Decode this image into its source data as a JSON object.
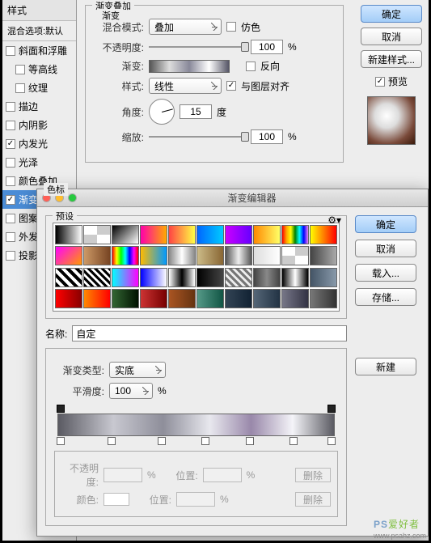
{
  "sidebar": {
    "header": "样式",
    "sub": "混合选项:默认",
    "items": [
      {
        "label": "斜面和浮雕",
        "checked": false
      },
      {
        "label": "等高线",
        "checked": false,
        "indent": true
      },
      {
        "label": "纹理",
        "checked": false,
        "indent": true
      },
      {
        "label": "描边",
        "checked": false
      },
      {
        "label": "内阴影",
        "checked": false
      },
      {
        "label": "内发光",
        "checked": true
      },
      {
        "label": "光泽",
        "checked": false
      },
      {
        "label": "颜色叠加",
        "checked": false
      },
      {
        "label": "渐变叠加",
        "checked": true,
        "active": true
      },
      {
        "label": "图案叠加",
        "checked": false
      },
      {
        "label": "外发光",
        "checked": false
      },
      {
        "label": "投影",
        "checked": false
      }
    ]
  },
  "gradientOverlay": {
    "legend": "渐变叠加",
    "subLegend": "渐变",
    "blendModeLabel": "混合模式:",
    "blendMode": "叠加",
    "ditherLabel": "仿色",
    "opacityLabel": "不透明度:",
    "opacity": "100",
    "pct": "%",
    "gradientLabel": "渐变:",
    "reverseLabel": "反向",
    "styleLabel": "样式:",
    "style": "线性",
    "alignLabel": "与图层对齐",
    "angleLabel": "角度:",
    "angle": "15",
    "deg": "度",
    "scaleLabel": "缩放:",
    "scale": "100"
  },
  "rightButtons": {
    "ok": "确定",
    "cancel": "取消",
    "newStyle": "新建样式...",
    "preview": "预览"
  },
  "editor": {
    "title": "渐变编辑器",
    "presetLabel": "预设",
    "nameLabel": "名称:",
    "nameValue": "自定",
    "newBtn": "新建",
    "ok": "确定",
    "cancel": "取消",
    "load": "载入...",
    "save": "存储...",
    "typeLabel": "渐变类型:",
    "type": "实底",
    "smoothLabel": "平滑度:",
    "smooth": "100",
    "pct": "%",
    "stopsLegend": "色标",
    "opLabel": "不透明度:",
    "posLabel": "位置:",
    "delBtn": "删除",
    "colorLabel": "颜色:"
  },
  "swatches": [
    "linear-gradient(90deg,#000,#fff)",
    "repeating-conic-gradient(#ccc 0 25%,#fff 0 50%)",
    "linear-gradient(135deg,#000,#fff)",
    "linear-gradient(90deg,#f0a,#fa0)",
    "linear-gradient(90deg,#f44,#ff4)",
    "linear-gradient(90deg,#06f,#0cf)",
    "linear-gradient(90deg,#c0f,#60f)",
    "linear-gradient(90deg,#f80,#ff6)",
    "linear-gradient(90deg,red,orange,yellow,green,cyan,blue,violet)",
    "linear-gradient(90deg,#ff0,#f00)",
    "linear-gradient(135deg,#f0f,#f90)",
    "linear-gradient(90deg,#c96,#742)",
    "linear-gradient(90deg,red,yellow,lime,cyan,blue,magenta,red)",
    "linear-gradient(90deg,#fb0,#09f)",
    "linear-gradient(90deg,#888,#fff,#888)",
    "linear-gradient(90deg,#cb8,#863)",
    "linear-gradient(90deg,#555,#eee,#555)",
    "linear-gradient(90deg,#ddd,#fff)",
    "repeating-conic-gradient(#ccc 0 25%,#fff 0 50%)",
    "linear-gradient(90deg,#444,#aaa)",
    "repeating-linear-gradient(45deg,#000 0 4px,#fff 4px 8px)",
    "repeating-linear-gradient(45deg,#000 0 3px,#fff 3px 6px)",
    "linear-gradient(90deg,#0ff,#f0f)",
    "linear-gradient(90deg,#00f,#fff)",
    "linear-gradient(90deg,#fff,#000,#fff)",
    "linear-gradient(90deg,#000,#444)",
    "repeating-linear-gradient(45deg,#777 0 3px,#eee 3px 6px)",
    "linear-gradient(90deg,#444,#888,#444)",
    "linear-gradient(90deg,#000,#fff,#000)",
    "linear-gradient(90deg,#456,#89a)",
    "linear-gradient(90deg,#f00,#800)",
    "linear-gradient(90deg,#f80,#f00)",
    "linear-gradient(90deg,#363,#010)",
    "linear-gradient(90deg,#c33,#700)",
    "linear-gradient(90deg,#a52,#631)",
    "linear-gradient(90deg,#598,#154)",
    "linear-gradient(90deg,#345,#123)",
    "linear-gradient(90deg,#567,#234)",
    "linear-gradient(90deg,#778,#334)",
    "linear-gradient(90deg,#777,#333)"
  ],
  "watermark": {
    "ps": "PS",
    "zh": "爱好者",
    "sub": "www.psahz.com"
  }
}
